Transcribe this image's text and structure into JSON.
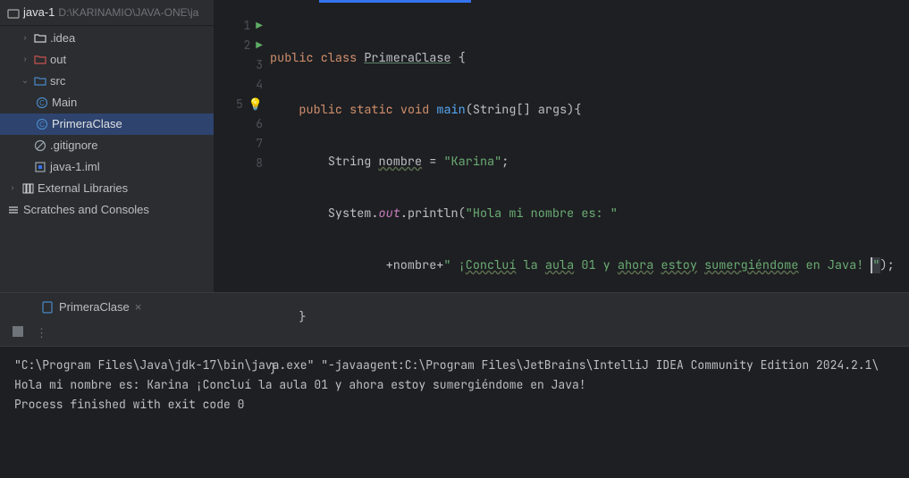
{
  "project": {
    "name": "java-1",
    "path": "D:\\KARINAMIO\\JAVA-ONE\\ja"
  },
  "tree": {
    "idea": ".idea",
    "out": "out",
    "src": "src",
    "main": "Main",
    "primera": "PrimeraClase",
    "gitignore": ".gitignore",
    "iml": "java-1.iml",
    "libs": "External Libraries",
    "scratch": "Scratches and Consoles"
  },
  "code": {
    "l1": {
      "kw1": "public",
      "kw2": "class",
      "cls": "PrimeraClase",
      "brace": " {"
    },
    "l2": {
      "indent": "    ",
      "kw1": "public",
      "kw2": "static",
      "kw3": "void",
      "method": "main",
      "params": "(String[] args){"
    },
    "l3": {
      "indent": "        ",
      "type": "String",
      "var": "nombre",
      "eq": " = ",
      "str": "\"Karina\"",
      "semi": ";"
    },
    "l4": {
      "indent": "        ",
      "sys": "System.",
      "out": "out",
      "dot": ".",
      "println": "println",
      "paren": "(",
      "str": "\"Hola mi nombre es: \""
    },
    "l5": {
      "indent": "                ",
      "plus": "+nombre+",
      "str1": "\" ¡",
      "sp1": "Concluí",
      "sp2": " la ",
      "sp3": "aula",
      "sp4": " 01 y ",
      "sp5": "ahora",
      "sp6": " ",
      "sp7": "estoy",
      "sp8": " ",
      "sp9": "sumergiéndome",
      "sp10": " en Java! ",
      "strEnd": "\"",
      "close": ");"
    },
    "l6": {
      "indent": "    ",
      "brace": "}"
    },
    "l7": {
      "brace": "}"
    }
  },
  "run": {
    "tab": "PrimeraClase",
    "console": {
      "l1": "\"C:\\Program Files\\Java\\jdk-17\\bin\\java.exe\" \"-javaagent:C:\\Program Files\\JetBrains\\IntelliJ IDEA Community Edition 2024.2.1\\",
      "l2": "Hola mi nombre es: Karina ¡Concluí la aula 01 y ahora estoy sumergiéndome en Java! ",
      "l3": "",
      "l4": "Process finished with exit code 0"
    }
  }
}
